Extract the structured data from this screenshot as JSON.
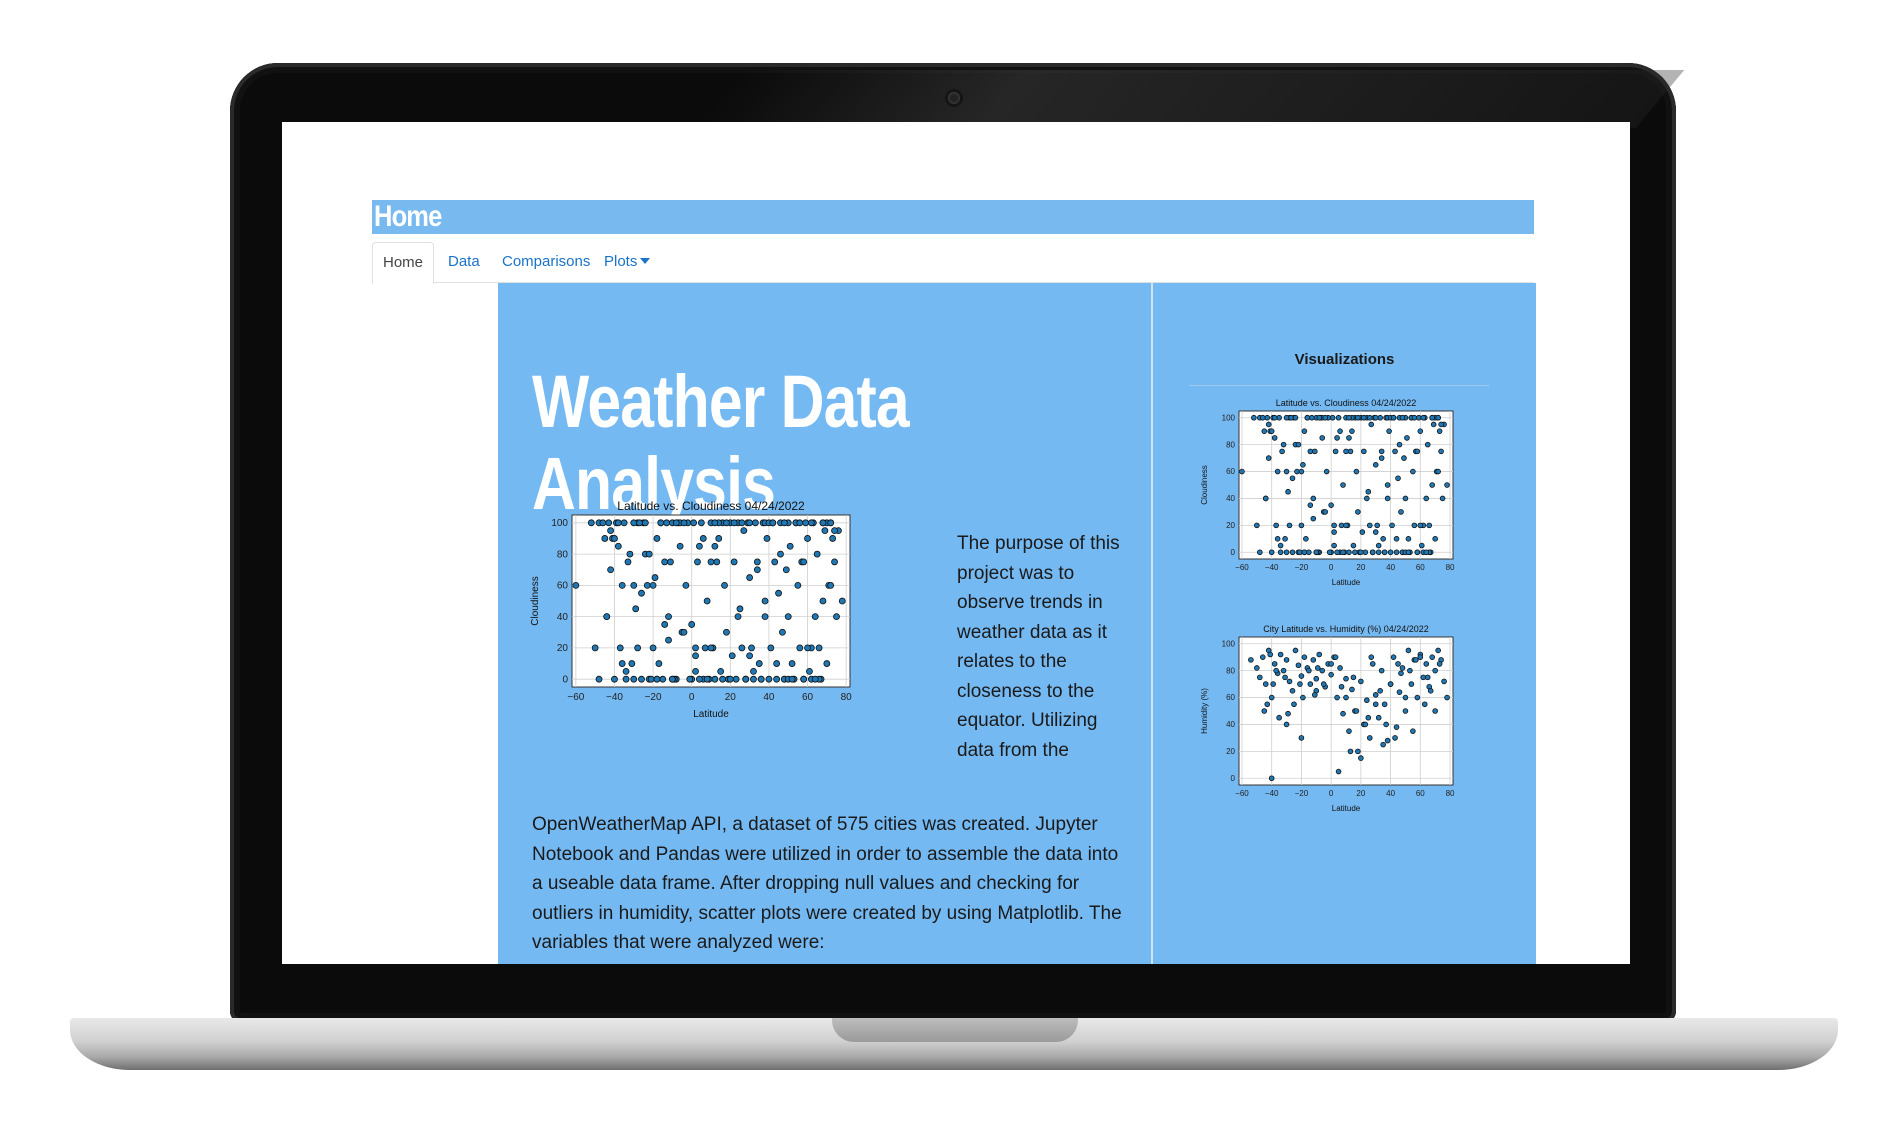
{
  "page": {
    "banner_title": "Home",
    "tabs": [
      {
        "label": "Home",
        "active": true
      },
      {
        "label": "Data",
        "active": false
      },
      {
        "label": "Comparisons",
        "active": false
      },
      {
        "label": "Plots",
        "active": false,
        "dropdown": true
      }
    ],
    "heading_line1": "Weather Data",
    "heading_line2": "Analysis",
    "paragraph_right": "The purpose of this project was to observe trends in weather data as it relates to the closeness to the equator. Utilizing data from the",
    "paragraph_bottom": "OpenWeatherMap API, a dataset of 575 cities was created. Jupyter Notebook and Pandas were utilized in order to assemble the data into a useable data frame. After dropping null values and checking for outliers in humidity, scatter plots were created by using Matplotlib. The variables that were analyzed were:",
    "visualizations_title": "Visualizations",
    "colors": {
      "accent": "#75b9f2",
      "link": "#1a73c9",
      "point": "#1f77b4"
    }
  },
  "chart_data": [
    {
      "type": "scatter",
      "title": "Latitude vs. Cloudiness 04/24/2022",
      "xlabel": "Latitude",
      "ylabel": "Cloudiness",
      "xlim": [
        -62,
        82
      ],
      "ylim": [
        -5,
        105
      ],
      "xticks": [
        "−60",
        "−40",
        "−20",
        "0",
        "20",
        "40",
        "60",
        "80"
      ],
      "xtick_values": [
        -60,
        -40,
        -20,
        0,
        20,
        40,
        60,
        80
      ],
      "yticks": [
        "0",
        "20",
        "40",
        "60",
        "80",
        "100"
      ],
      "ytick_values": [
        0,
        20,
        40,
        60,
        80,
        100
      ],
      "grid": true,
      "x": [
        -60,
        -52,
        -48,
        -45,
        -44,
        -43,
        -42,
        -40,
        -38,
        -36,
        -35,
        -33,
        -30,
        -28,
        -26,
        -25,
        -24,
        -22,
        -20,
        -19,
        -18,
        -17,
        -16,
        -15,
        -14,
        -12,
        -10,
        -8,
        -6,
        -5,
        -3,
        -2,
        0,
        2,
        3,
        5,
        6,
        8,
        10,
        11,
        12,
        13,
        14,
        15,
        16,
        17,
        18,
        19,
        20,
        21,
        22,
        23,
        24,
        25,
        26,
        27,
        28,
        29,
        30,
        31,
        32,
        33,
        34,
        35,
        36,
        37,
        38,
        39,
        40,
        41,
        42,
        43,
        44,
        45,
        46,
        47,
        48,
        49,
        50,
        51,
        52,
        53,
        54,
        55,
        56,
        57,
        58,
        59,
        60,
        61,
        62,
        63,
        64,
        65,
        66,
        67,
        68,
        69,
        70,
        71,
        72,
        73,
        74,
        75,
        76,
        78,
        -46,
        -41,
        -37,
        -32,
        -29,
        -27,
        -23,
        -21,
        -13,
        -11,
        -9,
        -7,
        -4,
        -1,
        1,
        4,
        7,
        9,
        -44,
        -39,
        -34,
        -31,
        -22,
        -18,
        -14,
        -6,
        2,
        8,
        12,
        18,
        24,
        28,
        34,
        38,
        44,
        48,
        54,
        58,
        62,
        66,
        70,
        74,
        -48,
        -40,
        -36,
        -30,
        -26,
        -20,
        -16,
        -10,
        -4,
        0,
        4,
        10,
        14,
        20,
        26,
        30,
        36,
        40,
        46,
        50,
        56,
        60,
        64,
        68,
        72,
        -42,
        -34,
        -24,
        -12,
        6,
        16,
        22,
        32,
        42,
        52,
        62,
        72,
        -38,
        -28,
        -18,
        -8,
        2,
        12,
        28,
        38,
        48,
        58,
        68,
        -50,
        -30,
        -10,
        10,
        30,
        50,
        70
      ],
      "y": [
        60,
        100,
        100,
        90,
        40,
        100,
        95,
        0,
        85,
        60,
        100,
        75,
        0,
        100,
        55,
        100,
        80,
        0,
        20,
        65,
        90,
        10,
        100,
        0,
        75,
        40,
        100,
        0,
        85,
        30,
        60,
        100,
        0,
        5,
        75,
        100,
        0,
        50,
        100,
        20,
        0,
        75,
        90,
        5,
        100,
        60,
        30,
        0,
        100,
        15,
        75,
        0,
        100,
        45,
        20,
        95,
        0,
        100,
        65,
        20,
        0,
        100,
        75,
        10,
        0,
        100,
        50,
        90,
        0,
        20,
        100,
        75,
        0,
        55,
        100,
        30,
        0,
        70,
        100,
        85,
        10,
        0,
        100,
        60,
        20,
        75,
        0,
        100,
        90,
        5,
        0,
        100,
        40,
        80,
        20,
        0,
        100,
        95,
        10,
        60,
        100,
        90,
        75,
        40,
        95,
        50,
        100,
        90,
        20,
        80,
        45,
        100,
        60,
        0,
        100,
        75,
        0,
        100,
        30,
        0,
        100,
        85,
        20,
        0,
        40,
        100,
        5,
        10,
        80,
        0,
        35,
        100,
        20,
        0,
        85,
        100,
        40,
        0,
        70,
        100,
        10,
        0,
        100,
        75,
        20,
        0,
        100,
        95,
        0,
        90,
        10,
        100,
        0,
        60,
        100,
        0,
        100,
        35,
        0,
        20,
        100,
        0,
        100,
        15,
        0,
        100,
        80,
        0,
        100,
        20,
        0,
        50,
        100,
        70,
        0,
        100,
        25,
        90,
        0,
        100,
        5,
        100,
        0,
        100,
        60,
        100,
        20,
        0,
        100,
        15,
        100,
        0,
        40,
        100,
        0,
        100,
        20,
        60,
        0,
        75,
        100,
        40
      ],
      "series_color": "#1f77b4"
    },
    {
      "type": "scatter",
      "title": "City Latitude vs. Humidity (%) 04/24/2022",
      "xlabel": "Latitude",
      "ylabel": "Humidity (%)",
      "xlim": [
        -62,
        82
      ],
      "ylim": [
        -5,
        105
      ],
      "xticks": [
        "−60",
        "−40",
        "−20",
        "0",
        "20",
        "40",
        "60",
        "80"
      ],
      "xtick_values": [
        -60,
        -40,
        -20,
        0,
        20,
        40,
        60,
        80
      ],
      "yticks": [
        "0",
        "20",
        "40",
        "60",
        "80",
        "100"
      ],
      "ytick_values": [
        0,
        20,
        40,
        60,
        80,
        100
      ],
      "grid": true,
      "x": [
        -54,
        -50,
        -48,
        -46,
        -44,
        -42,
        -40,
        -38,
        -36,
        -34,
        -32,
        -30,
        -28,
        -26,
        -24,
        -22,
        -20,
        -18,
        -16,
        -14,
        -12,
        -10,
        -8,
        -6,
        -4,
        -2,
        0,
        2,
        4,
        6,
        8,
        10,
        12,
        14,
        16,
        18,
        20,
        22,
        24,
        26,
        28,
        30,
        32,
        34,
        36,
        38,
        40,
        42,
        44,
        46,
        48,
        50,
        52,
        54,
        56,
        58,
        60,
        62,
        64,
        66,
        68,
        70,
        72,
        74,
        76,
        78,
        -45,
        -40,
        -35,
        -30,
        -25,
        -20,
        -15,
        -10,
        -5,
        0,
        5,
        10,
        15,
        20,
        25,
        30,
        35,
        40,
        45,
        50,
        55,
        60,
        65,
        70,
        -43,
        -37,
        -29,
        -21,
        -11,
        3,
        13,
        23,
        33,
        43,
        53,
        63,
        73,
        -39,
        -31,
        -19,
        -9,
        7,
        17,
        27,
        37,
        47,
        57,
        67,
        -41
      ],
      "y": [
        88,
        82,
        75,
        90,
        70,
        95,
        0,
        85,
        78,
        92,
        80,
        88,
        72,
        65,
        95,
        84,
        76,
        90,
        82,
        70,
        88,
        74,
        92,
        80,
        68,
        85,
        77,
        90,
        60,
        82,
        48,
        74,
        35,
        66,
        50,
        20,
        72,
        40,
        58,
        30,
        85,
        62,
        45,
        80,
        55,
        28,
        70,
        90,
        38,
        64,
        82,
        50,
        95,
        70,
        88,
        60,
        92,
        75,
        85,
        68,
        90,
        80,
        95,
        88,
        72,
        60,
        50,
        60,
        45,
        40,
        55,
        30,
        80,
        65,
        70,
        85,
        5,
        60,
        75,
        15,
        45,
        55,
        25,
        70,
        85,
        60,
        35,
        90,
        75,
        50,
        55,
        80,
        48,
        70,
        62,
        90,
        20,
        40,
        65,
        30,
        80,
        55,
        85,
        70,
        75,
        60,
        82,
        68,
        50,
        90,
        40,
        78,
        88,
        65,
        92,
        85
      ],
      "series_color": "#1f77b4"
    }
  ]
}
